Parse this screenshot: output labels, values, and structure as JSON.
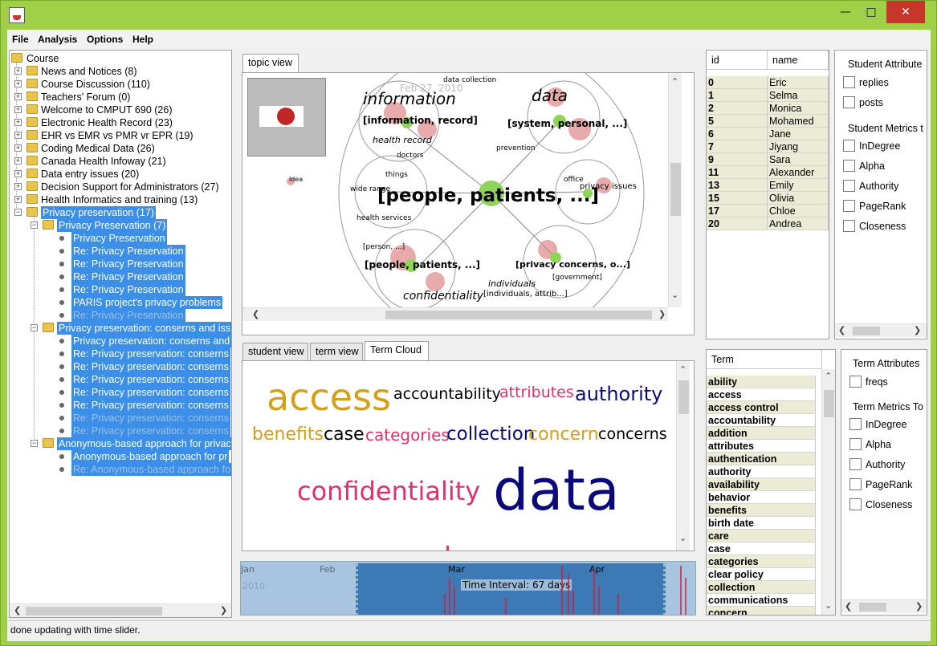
{
  "menubar": {
    "file": "File",
    "analysis": "Analysis",
    "options": "Options",
    "help": "Help"
  },
  "tree": {
    "root": "Course",
    "forums": [
      "News and Notices (8)",
      "Course Discussion (110)",
      "Teachers' Forum (0)",
      "Welcome to CMPUT 690 (26)",
      "Electronic Health Record (23)",
      "EHR vs EMR vs PMR vr EPR (19)",
      "Coding Medical Data (26)",
      "Canada Health Infoway (21)",
      "Data entry issues (20)",
      "Decision Support for Administrators (27)",
      "Health Informatics and training (13)"
    ],
    "selected_forum": "Privacy preservation (17)",
    "thread1": "Privacy Preservation (7)",
    "thread1_posts": [
      "Privacy Preservation",
      "Re: Privacy Preservation",
      "Re: Privacy Preservation",
      "Re: Privacy Preservation",
      "Re: Privacy Preservation",
      "PARIS project's privacy problems",
      "Re: Privacy Preservation"
    ],
    "thread2": "Privacy preservation: conserns and iss",
    "thread2_posts": [
      "Privacy preservation: conserns and",
      "Re: Privacy preservation: conserns",
      "Re: Privacy preservation: conserns",
      "Re: Privacy preservation: conserns",
      "Re: Privacy preservation: conserns",
      "Re: Privacy preservation: conserns",
      "Re: Privacy preservation: conserns",
      "Re: Privacy preservation: conserns"
    ],
    "thread3": "Anonymous-based approach for privac",
    "thread3_posts": [
      "Anonymous-based approach for pr",
      "Re: Anonymous-based approach fo"
    ]
  },
  "topic_view": {
    "tab": "topic view",
    "center_label": "[people, patients, ...]",
    "labels": [
      "information",
      "data",
      "[information, record]",
      "[system, personal, ...]",
      "health record",
      "doctors",
      "prevention",
      "things",
      "wide range",
      "health services",
      "privacy issues",
      "office",
      "[person, ...]",
      "[people, patients, ...]",
      "[privacy concerns, o...]",
      "[government]",
      "confidentiality",
      "individuals",
      "[individuals, attrib...]",
      "data collection",
      "Feb 27, 2010",
      "idea"
    ]
  },
  "lower_tabs": {
    "student": "student view",
    "term": "term view",
    "cloud": "Term Cloud"
  },
  "term_cloud": {
    "words": [
      {
        "text": "access",
        "color": "#d4a017"
      },
      {
        "text": "accountability",
        "color": "#000000"
      },
      {
        "text": "attributes",
        "color": "#e0316a"
      },
      {
        "text": "authority",
        "color": "#0a0a78"
      },
      {
        "text": "benefits",
        "color": "#d4a017"
      },
      {
        "text": "case",
        "color": "#000000"
      },
      {
        "text": "categories",
        "color": "#e0316a"
      },
      {
        "text": "collection",
        "color": "#0a0a78"
      },
      {
        "text": "concern",
        "color": "#d4a017"
      },
      {
        "text": "concerns",
        "color": "#000000"
      },
      {
        "text": "confidentiality",
        "color": "#e0316a"
      },
      {
        "text": "data",
        "color": "#0a0a78"
      }
    ]
  },
  "timeline": {
    "months": [
      "Jan",
      "Feb",
      "Mar",
      "Apr"
    ],
    "year": "2010",
    "interval": "Time Interval: 67 days"
  },
  "students": {
    "col_id": "id",
    "col_name": "name",
    "rows": [
      {
        "id": "0",
        "name": "Eric"
      },
      {
        "id": "1",
        "name": "Selma"
      },
      {
        "id": "2",
        "name": "Monica"
      },
      {
        "id": "5",
        "name": "Mohamed"
      },
      {
        "id": "6",
        "name": "Jane"
      },
      {
        "id": "7",
        "name": "Jiyang"
      },
      {
        "id": "9",
        "name": "Sara"
      },
      {
        "id": "11",
        "name": "Alexander"
      },
      {
        "id": "13",
        "name": "Emily"
      },
      {
        "id": "15",
        "name": "Olivia"
      },
      {
        "id": "17",
        "name": "Chloe"
      },
      {
        "id": "20",
        "name": "Andrea"
      }
    ]
  },
  "student_attrs": {
    "title": "Student Attribute",
    "items": [
      "replies",
      "posts"
    ]
  },
  "student_metrics": {
    "title": "Student Metrics t",
    "items": [
      "InDegree",
      "Alpha",
      "Authority",
      "PageRank",
      "Closeness"
    ]
  },
  "terms": {
    "col": "Term",
    "rows": [
      "ability",
      "access",
      "access control",
      "accountability",
      "addition",
      "attributes",
      "authentication",
      "authority",
      "availability",
      "behavior",
      "benefits",
      "birth date",
      "care",
      "case",
      "categories",
      "clear policy",
      "collection",
      "communications",
      "concern"
    ]
  },
  "term_attrs": {
    "title": "Term Attributes",
    "items": [
      "freqs"
    ]
  },
  "term_metrics": {
    "title": "Term Metrics To",
    "items": [
      "InDegree",
      "Alpha",
      "Authority",
      "PageRank",
      "Closeness"
    ]
  },
  "status": "done updating with time slider."
}
